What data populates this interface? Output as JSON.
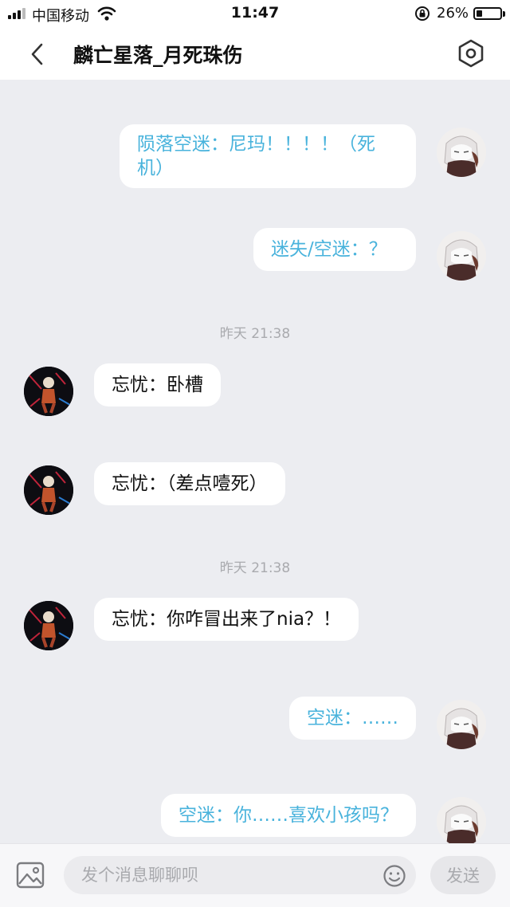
{
  "status_bar": {
    "carrier": "中国移动",
    "time": "11:47",
    "battery_percent": "26%",
    "battery_level": 0.26
  },
  "header": {
    "title": "麟亡星落_月死珠伤",
    "back_icon": "chevron-left-icon",
    "settings_icon": "hexagon-settings-icon"
  },
  "messages": [
    {
      "side": "mine",
      "text": "陨落空迷：尼玛！！！！（死\n机）"
    },
    {
      "side": "mine",
      "text": "迷失/空迷：？"
    },
    {
      "type": "time",
      "text": "昨天 21:38"
    },
    {
      "side": "theirs",
      "text": "忘忧：卧槽"
    },
    {
      "side": "theirs",
      "text": "忘忧：（差点噎死）"
    },
    {
      "type": "time",
      "text": "昨天 21:38"
    },
    {
      "side": "theirs",
      "text": "忘忧：你咋冒出来了nia？！"
    },
    {
      "side": "mine",
      "text": "空迷：……"
    },
    {
      "side": "mine",
      "text": "空迷：你……喜欢小孩吗？"
    }
  ],
  "input_bar": {
    "placeholder": "发个消息聊聊呗",
    "send_label": "发送",
    "image_icon": "image-icon",
    "emoji_icon": "emoji-icon"
  },
  "colors": {
    "mine_text": "#49b3dc",
    "background": "#ecedf1"
  }
}
